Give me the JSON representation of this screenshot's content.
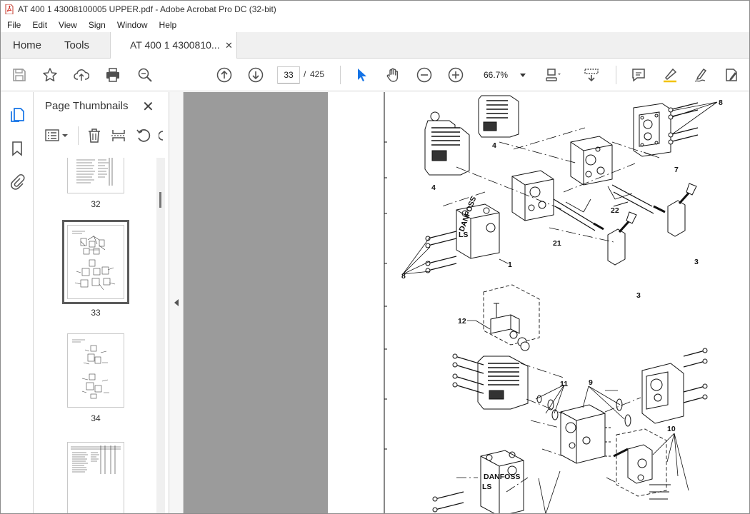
{
  "window": {
    "title": "AT 400 1 43008100005 UPPER.pdf - Adobe Acrobat Pro DC (32-bit)"
  },
  "menu": {
    "items": [
      "File",
      "Edit",
      "View",
      "Sign",
      "Window",
      "Help"
    ]
  },
  "tabs": {
    "home": "Home",
    "tools": "Tools",
    "document": "AT 400 1 4300810...",
    "close_glyph": "✕"
  },
  "toolbar": {
    "current_page": "33",
    "slash": "/",
    "total_pages": "425",
    "zoom": "66.7%"
  },
  "panel": {
    "title": "Page Thumbnails",
    "close_glyph": "✕",
    "thumbnails": [
      {
        "label": "32"
      },
      {
        "label": "33"
      },
      {
        "label": "34"
      },
      {
        "label": ""
      }
    ]
  },
  "drawing": {
    "callouts": [
      "8",
      "4",
      "4",
      "7",
      "22",
      "3",
      "21",
      "1",
      "8",
      "3",
      "12",
      "11",
      "9",
      "10"
    ],
    "brand_text": "DANFOSS",
    "port_text": "LS"
  },
  "colors": {
    "accent_blue": "#1473e6",
    "icon_grey": "#505050",
    "page_grey": "#9b9b9b"
  }
}
